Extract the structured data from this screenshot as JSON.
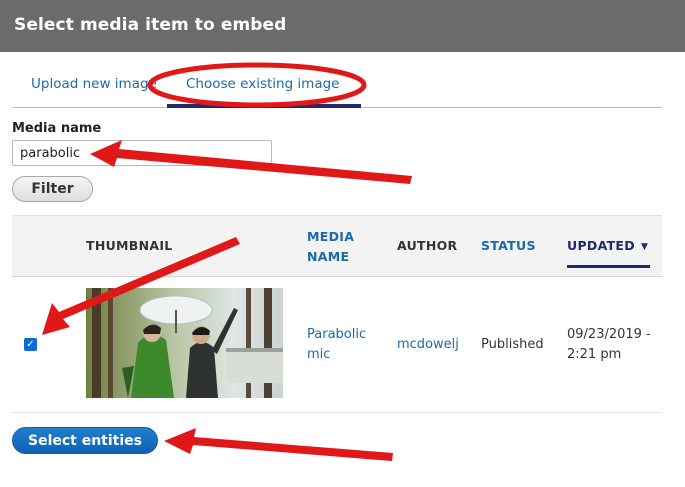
{
  "dialog": {
    "title": "Select media item to embed"
  },
  "tabs": [
    {
      "label": "Upload new image",
      "active": false
    },
    {
      "label": "Choose existing image",
      "active": true
    }
  ],
  "filter": {
    "label": "Media name",
    "value": "parabolic",
    "button_label": "Filter"
  },
  "table": {
    "headers": {
      "thumbnail": "THUMBNAIL",
      "media_name": "MEDIA NAME",
      "author": "AUTHOR",
      "status": "STATUS",
      "updated": "UPDATED"
    },
    "sort": {
      "column": "updated",
      "icon": "sort-desc-icon",
      "glyph": "▼"
    },
    "rows": [
      {
        "selected": true,
        "check_glyph": "✓",
        "media_name": "Parabolic mic",
        "author": "mcdowelj",
        "status": "Published",
        "updated": "09/23/2019 - 2:21 pm"
      }
    ]
  },
  "actions": {
    "select_label": "Select entities"
  },
  "colors": {
    "titlebar": "#6b6b6b",
    "link": "#1b6aa8",
    "active_tab": "#1f2a6e",
    "primary_button": "#0f63b3",
    "annotation": "#e01818"
  }
}
